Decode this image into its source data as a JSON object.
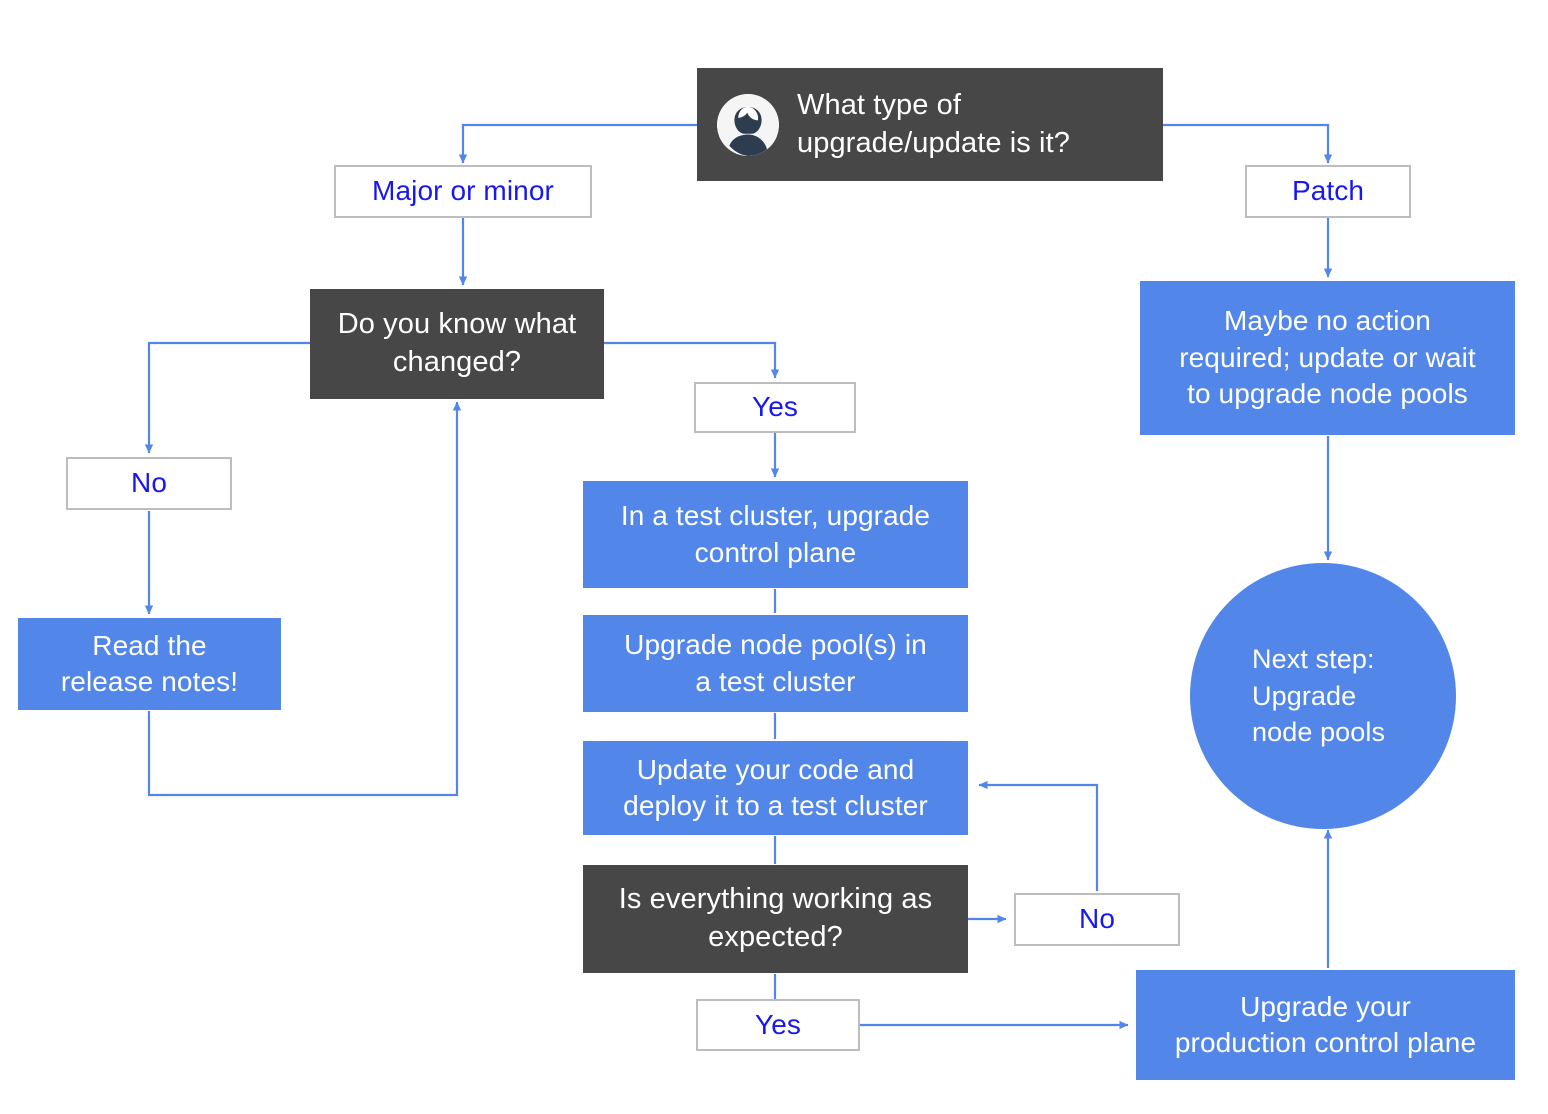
{
  "diagram": {
    "title": "What type of upgrade/update is it?",
    "colors": {
      "dark": "#474747",
      "blue": "#5286e9",
      "outline_border": "#bdbdbd",
      "outline_text": "#1818ee",
      "connector": "#5286e9",
      "canvas": "#ffffff"
    }
  },
  "nodes": {
    "start_question": {
      "label": "What type of\nupgrade/update is it?",
      "kind": "dark",
      "icon": "user-avatar-icon"
    },
    "major_or_minor": {
      "label": "Major or minor",
      "kind": "outline"
    },
    "patch": {
      "label": "Patch",
      "kind": "outline"
    },
    "know_what_changed": {
      "label": "Do you know what\nchanged?",
      "kind": "dark"
    },
    "changed_no": {
      "label": "No",
      "kind": "outline"
    },
    "read_release_notes": {
      "label": "Read the\nrelease notes!",
      "kind": "blue"
    },
    "changed_yes": {
      "label": "Yes",
      "kind": "outline"
    },
    "test_upgrade_control_plane": {
      "label": "In a test cluster, upgrade\ncontrol plane",
      "kind": "blue"
    },
    "test_upgrade_node_pools": {
      "label": "Upgrade node pool(s) in\na test cluster",
      "kind": "blue"
    },
    "update_code_deploy": {
      "label": "Update your code and\ndeploy it to a test cluster",
      "kind": "blue"
    },
    "everything_working": {
      "label": "Is everything working as\nexpected?",
      "kind": "dark"
    },
    "working_no": {
      "label": "No",
      "kind": "outline"
    },
    "working_yes": {
      "label": "Yes",
      "kind": "outline"
    },
    "maybe_no_action": {
      "label": "Maybe no action\nrequired; update or wait\nto upgrade node pools",
      "kind": "blue"
    },
    "upgrade_production_control_plane": {
      "label": "Upgrade your\nproduction control plane",
      "kind": "blue"
    },
    "next_step": {
      "label": "Next step:\nUpgrade\nnode pools",
      "kind": "circle"
    }
  },
  "edges": [
    {
      "from": "start_question",
      "to": "major_or_minor",
      "label": ""
    },
    {
      "from": "start_question",
      "to": "patch",
      "label": ""
    },
    {
      "from": "major_or_minor",
      "to": "know_what_changed",
      "label": ""
    },
    {
      "from": "know_what_changed",
      "to": "changed_no",
      "label": ""
    },
    {
      "from": "changed_no",
      "to": "read_release_notes",
      "label": ""
    },
    {
      "from": "read_release_notes",
      "to": "know_what_changed",
      "label": ""
    },
    {
      "from": "know_what_changed",
      "to": "changed_yes",
      "label": ""
    },
    {
      "from": "changed_yes",
      "to": "test_upgrade_control_plane",
      "label": ""
    },
    {
      "from": "test_upgrade_control_plane",
      "to": "test_upgrade_node_pools",
      "label": ""
    },
    {
      "from": "test_upgrade_node_pools",
      "to": "update_code_deploy",
      "label": ""
    },
    {
      "from": "update_code_deploy",
      "to": "everything_working",
      "label": ""
    },
    {
      "from": "everything_working",
      "to": "working_no",
      "label": ""
    },
    {
      "from": "working_no",
      "to": "update_code_deploy",
      "label": ""
    },
    {
      "from": "everything_working",
      "to": "working_yes",
      "label": ""
    },
    {
      "from": "working_yes",
      "to": "upgrade_production_control_plane",
      "label": ""
    },
    {
      "from": "patch",
      "to": "maybe_no_action",
      "label": ""
    },
    {
      "from": "maybe_no_action",
      "to": "next_step",
      "label": ""
    },
    {
      "from": "upgrade_production_control_plane",
      "to": "next_step",
      "label": ""
    }
  ]
}
